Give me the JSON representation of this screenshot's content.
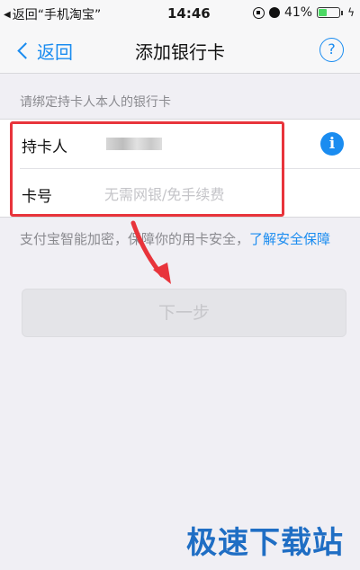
{
  "status_bar": {
    "back_app": "返回“手机淘宝”",
    "time": "14:46",
    "battery": "41%",
    "battery_level": 0.41
  },
  "nav": {
    "back_label": "返回",
    "title": "添加银行卡",
    "help_symbol": "?"
  },
  "section_header": "请绑定持卡人本人的银行卡",
  "form": {
    "holder_label": "持卡人",
    "card_label": "卡号",
    "card_placeholder": "无需网银/免手续费",
    "info_symbol": "i"
  },
  "security_note": {
    "text": "支付宝智能加密，保障你的用卡安全，",
    "link": "了解安全保障"
  },
  "next_button": "下一步",
  "watermark": "极速下载站",
  "colors": {
    "accent": "#1a8cf0",
    "highlight": "#e8343b",
    "watermark": "#1f6ec4"
  }
}
